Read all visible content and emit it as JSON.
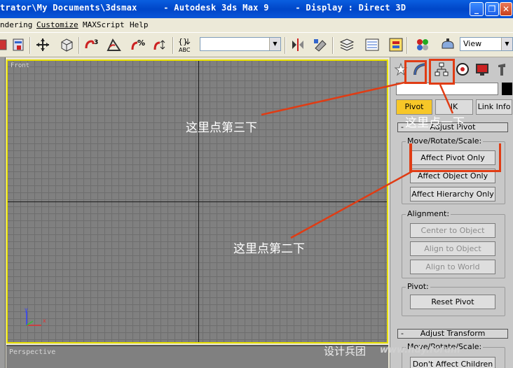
{
  "window": {
    "title": "trator\\My Documents\\3dsmax     - Autodesk 3ds Max 9     - Display : Direct 3D",
    "minimize": "_",
    "restore": "❐",
    "close": "✕"
  },
  "menu": [
    "ndering",
    "Customize",
    "MAXScript",
    "Help"
  ],
  "toolbar": {
    "selection_set_value": "",
    "view_value": "View"
  },
  "viewports": {
    "front_label": "Front",
    "perspective_label": "Perspective",
    "axis_x": "x",
    "axis_y": "y"
  },
  "command_panel": {
    "tabs": [
      "create-icon",
      "modify-icon",
      "hierarchy-icon",
      "motion-icon",
      "display-icon",
      "utilities-icon"
    ],
    "hierarchy_buttons": [
      "Pivot",
      "IK",
      "Link Info"
    ],
    "adjust_pivot": {
      "title": "Adjust Pivot",
      "move_rotate_scale_label": "Move/Rotate/Scale:",
      "affect_pivot_only": "Affect Pivot Only",
      "affect_object_only": "Affect Object Only",
      "affect_hierarchy_only": "Affect Hierarchy Only",
      "alignment_label": "Alignment:",
      "center_to_object": "Center to Object",
      "align_to_object": "Align to Object",
      "align_to_world": "Align to World",
      "pivot_label": "Pivot:",
      "reset_pivot": "Reset Pivot"
    },
    "adjust_transform": {
      "title": "Adjust Transform",
      "move_rotate_scale_label": "Move/Rotate/Scale:",
      "dont_affect_children": "Don't Affect Children"
    }
  },
  "annotations": {
    "third_click": "这里点第三下",
    "second_click": "这里点第二下",
    "first_click": "这里点一下",
    "color": "#e03c14"
  },
  "watermark": {
    "brand": "设计兵团",
    "url": "www.hdy.forum"
  }
}
